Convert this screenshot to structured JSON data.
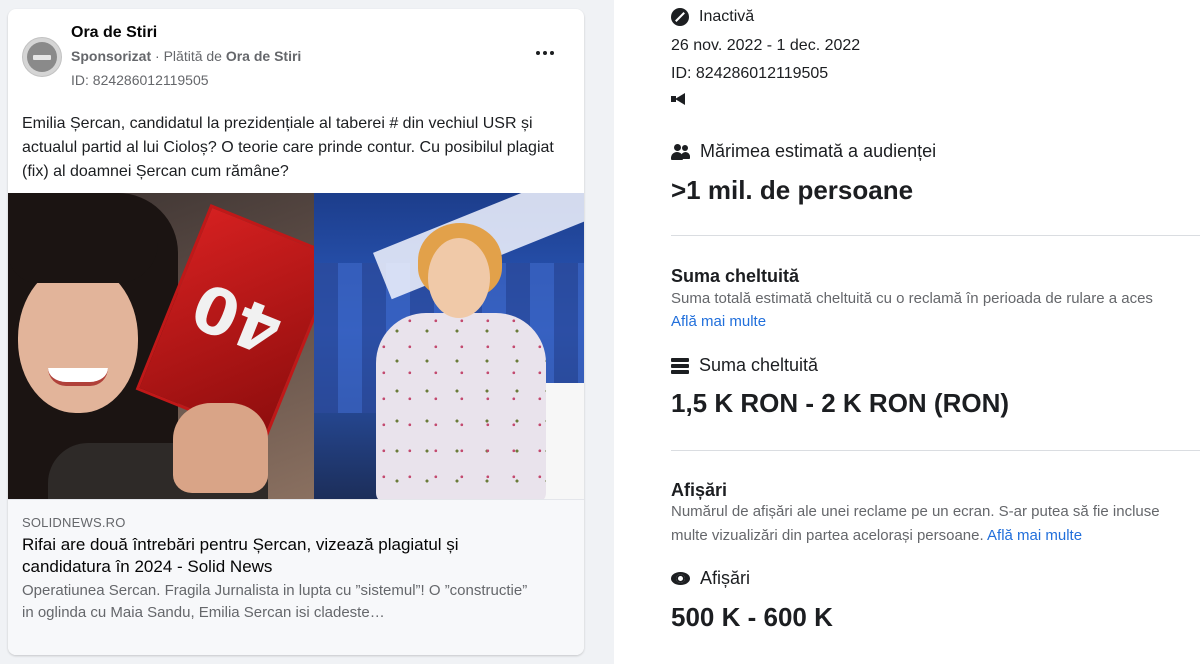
{
  "ad_card": {
    "page_name": "Ora de Stiri",
    "sponsored": "Sponsorizat",
    "paid_by_prefix": "Plătită de",
    "paid_by": "Ora de Stiri",
    "ad_id": "ID: 824286012119505",
    "body": "Emilia Șercan, candidatul la prezidențiale al taberei # din vechiul USR și actualul partid al lui Cioloș? O teorie care prinde contur. Cu posibilul plagiat (fix) al doamnei Șercan cum rămâne?",
    "image_board_text": "40",
    "link": {
      "domain": "SOLIDNEWS.RO",
      "headline": "Rifai are două întrebări pentru Șercan, vizează plagiatul și candidatura în 2024 - Solid News",
      "description": "Operatiunea Sercan. Fragila Jurnalista in lupta cu ”sistemul”! O ”constructie” in oglinda cu Maia Sandu, Emilia Sercan isi cladeste…"
    }
  },
  "details": {
    "status": "Inactivă",
    "dates": "26 nov. 2022 - 1 dec. 2022",
    "ad_id": "ID: 824286012119505",
    "audience_label": "Mărimea estimată a audienței",
    "audience_value": ">1 mil. de persoane",
    "spend_title": "Suma cheltuită",
    "spend_description": "Suma totală estimată cheltuită cu o reclamă în perioada de rulare a aces",
    "spend_learn_more": "Află mai multe",
    "spend_label": "Suma cheltuită",
    "spend_value": "1,5 K RON - 2 K RON (RON)",
    "impressions_title": "Afișări",
    "impressions_description_1": "Numărul de afișări ale unei reclame pe un ecran. S-ar putea să fie incluse",
    "impressions_description_2": "multe vizualizări din partea acelorași persoane.",
    "impressions_learn_more": "Află mai multe",
    "impressions_label": "Afișări",
    "impressions_value": "500 K - 600 K"
  },
  "colors": {
    "link_blue": "#216fdb",
    "secondary_text": "#65676b",
    "background": "#f0f2f5"
  },
  "icons": [
    "more-options-icon",
    "inactive-status-icon",
    "megaphone-icon",
    "people-icon",
    "money-icon",
    "eye-icon"
  ]
}
